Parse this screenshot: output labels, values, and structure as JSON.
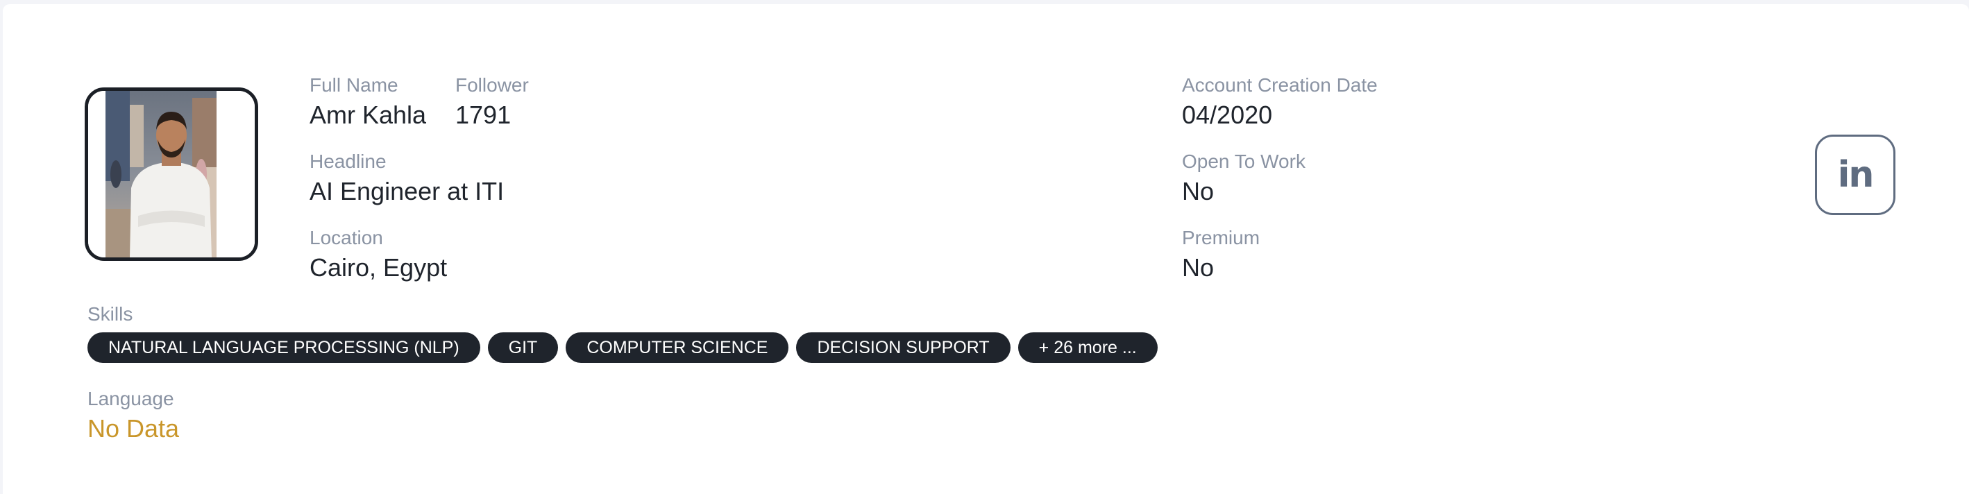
{
  "profile": {
    "full_name_label": "Full Name",
    "full_name": "Amr Kahla",
    "follower_label": "Follower",
    "follower": "1791",
    "headline_label": "Headline",
    "headline": "AI Engineer at ITI",
    "location_label": "Location",
    "location": "Cairo, Egypt",
    "account_creation_label": "Account Creation Date",
    "account_creation": "04/2020",
    "open_to_work_label": "Open To Work",
    "open_to_work": "No",
    "premium_label": "Premium",
    "premium": "No"
  },
  "skills": {
    "label": "Skills",
    "items": [
      "NATURAL LANGUAGE PROCESSING (NLP)",
      "GIT",
      "COMPUTER SCIENCE",
      "DECISION SUPPORT"
    ],
    "more": "+ 26 more ..."
  },
  "language": {
    "label": "Language",
    "value": "No Data"
  },
  "linkedin": {
    "icon": "linkedin-icon",
    "glyph": "in"
  },
  "colors": {
    "dark": "#1f242c",
    "muted": "#8a93a3",
    "accent": "#c9962a",
    "icon": "#5f6c80"
  }
}
